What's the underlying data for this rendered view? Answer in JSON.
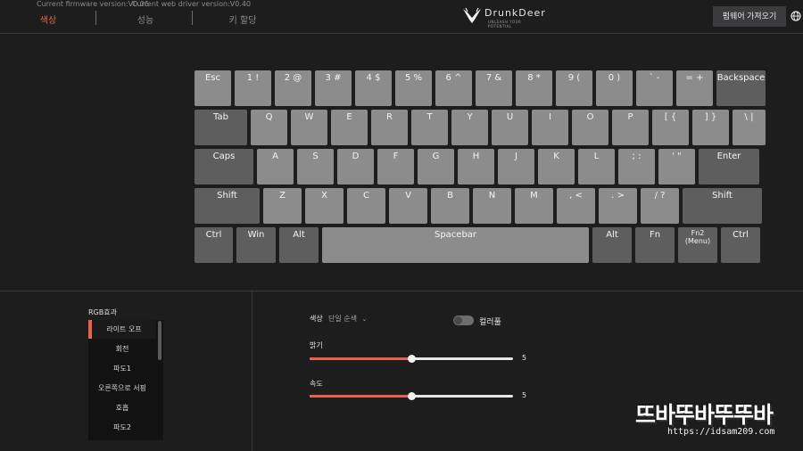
{
  "header": {
    "firmware_version": "Current firmware version:V0.06",
    "driver_version": "Current web driver version:V0.40",
    "tabs": [
      {
        "label": "색상",
        "active": true
      },
      {
        "label": "성능",
        "active": false
      },
      {
        "label": "키 할당",
        "active": false
      }
    ],
    "logo_text": "DrunkDeer",
    "logo_tagline": "UNLEASH YOUR POTENTIAL",
    "firmware_button": "펌웨어 가져오기",
    "icons": {
      "globe": "globe-icon",
      "logo": "deer-logo-icon"
    },
    "accent_color": "#e8634f"
  },
  "keyboard": {
    "rows": [
      [
        {
          "label": "Esc"
        },
        {
          "label": "1 !"
        },
        {
          "label": "2 @"
        },
        {
          "label": "3 #"
        },
        {
          "label": "4 $"
        },
        {
          "label": "5 %"
        },
        {
          "label": "6 ^"
        },
        {
          "label": "7 &"
        },
        {
          "label": "8 *"
        },
        {
          "label": "9 ("
        },
        {
          "label": "0 )"
        },
        {
          "label": "` -"
        },
        {
          "label": "= +"
        },
        {
          "label": "Backspace"
        }
      ],
      [
        {
          "label": "Tab"
        },
        {
          "label": "Q"
        },
        {
          "label": "W"
        },
        {
          "label": "E"
        },
        {
          "label": "R"
        },
        {
          "label": "T"
        },
        {
          "label": "Y"
        },
        {
          "label": "U"
        },
        {
          "label": "I"
        },
        {
          "label": "O"
        },
        {
          "label": "P"
        },
        {
          "label": "[ {"
        },
        {
          "label": "] }"
        },
        {
          "label": "\\ |"
        }
      ],
      [
        {
          "label": "Caps"
        },
        {
          "label": "A"
        },
        {
          "label": "S"
        },
        {
          "label": "D"
        },
        {
          "label": "F"
        },
        {
          "label": "G"
        },
        {
          "label": "H"
        },
        {
          "label": "J"
        },
        {
          "label": "K"
        },
        {
          "label": "L"
        },
        {
          "label": "; :"
        },
        {
          "label": "' \""
        },
        {
          "label": "Enter"
        }
      ],
      [
        {
          "label": "Shift"
        },
        {
          "label": "Z"
        },
        {
          "label": "X"
        },
        {
          "label": "C"
        },
        {
          "label": "V"
        },
        {
          "label": "B"
        },
        {
          "label": "N"
        },
        {
          "label": "M"
        },
        {
          "label": ", <"
        },
        {
          "label": ". >"
        },
        {
          "label": "/ ?"
        },
        {
          "label": "Shift"
        }
      ],
      [
        {
          "label": "Ctrl"
        },
        {
          "label": "Win"
        },
        {
          "label": "Alt"
        },
        {
          "label": "Spacebar"
        },
        {
          "label": "Alt"
        },
        {
          "label": "Fn"
        },
        {
          "label": "Fn2\n(Menu)"
        },
        {
          "label": "Ctrl"
        }
      ]
    ]
  },
  "effects": {
    "title": "RGB효과",
    "items": [
      "라이트 오프",
      "회전",
      "파도1",
      "오른쪽으로 서핑",
      "호흡",
      "파도2"
    ],
    "selected_index": 0
  },
  "settings": {
    "color_label": "색상",
    "color_mode": "단일 순색",
    "colorful_label": "컬러풀",
    "colorful_on": false,
    "brightness_label": "밝기",
    "brightness_value": "5",
    "brightness_fraction": 0.5,
    "speed_label": "속도",
    "speed_value": "5",
    "speed_fraction": 0.5
  },
  "watermark": {
    "title": "뜨바뚜바뚜뚜바",
    "url": "https://idsam209.com"
  }
}
